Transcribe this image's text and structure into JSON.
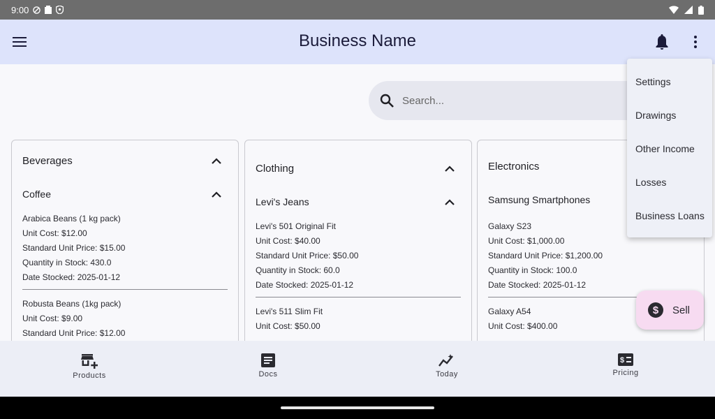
{
  "status": {
    "time": "9:00"
  },
  "appbar": {
    "title": "Business Name"
  },
  "search": {
    "placeholder": "Search..."
  },
  "categories": [
    {
      "title": "Beverages",
      "subcategory": "Coffee",
      "items": [
        {
          "name": "Arabica Beans (1 kg pack)",
          "unit_cost": "Unit Cost: $12.00",
          "price": "Standard Unit Price: $15.00",
          "qty": "Quantity in Stock: 430.0",
          "date": "Date Stocked: 2025-01-12"
        },
        {
          "name": "Robusta Beans (1kg pack)",
          "unit_cost": "Unit Cost: $9.00",
          "price": "Standard Unit Price: $12.00"
        }
      ]
    },
    {
      "title": "Clothing",
      "subcategory": "Levi's Jeans",
      "items": [
        {
          "name": "Levi's 501 Original Fit",
          "unit_cost": "Unit Cost: $40.00",
          "price": "Standard Unit Price: $50.00",
          "qty": "Quantity in Stock: 60.0",
          "date": "Date Stocked: 2025-01-12"
        },
        {
          "name": "Levi's 511 Slim Fit",
          "unit_cost": "Unit Cost: $50.00"
        }
      ]
    },
    {
      "title": "Electronics",
      "subcategory": "Samsung Smartphones",
      "items": [
        {
          "name": "Galaxy S23",
          "unit_cost": "Unit Cost: $1,000.00",
          "price": "Standard Unit Price: $1,200.00",
          "qty": "Quantity in Stock: 100.0",
          "date": "Date Stocked: 2025-01-12"
        },
        {
          "name": "Galaxy A54",
          "unit_cost": "Unit Cost: $400.00"
        }
      ]
    }
  ],
  "menu": {
    "items": [
      "Settings",
      "Drawings",
      "Other Income",
      "Losses",
      "Business Loans"
    ]
  },
  "fab": {
    "label": "Sell"
  },
  "bottomnav": {
    "tabs": [
      {
        "label": "Products",
        "icon": "add-business-icon"
      },
      {
        "label": "Docs",
        "icon": "article-icon"
      },
      {
        "label": "Today",
        "icon": "insights-icon"
      },
      {
        "label": "Pricing",
        "icon": "price-change-icon"
      }
    ]
  },
  "colors": {
    "appbar": "#dde3fb",
    "fab": "#f7dbf1",
    "bottomnav": "#eceef6",
    "status": "#6d6d6d"
  }
}
